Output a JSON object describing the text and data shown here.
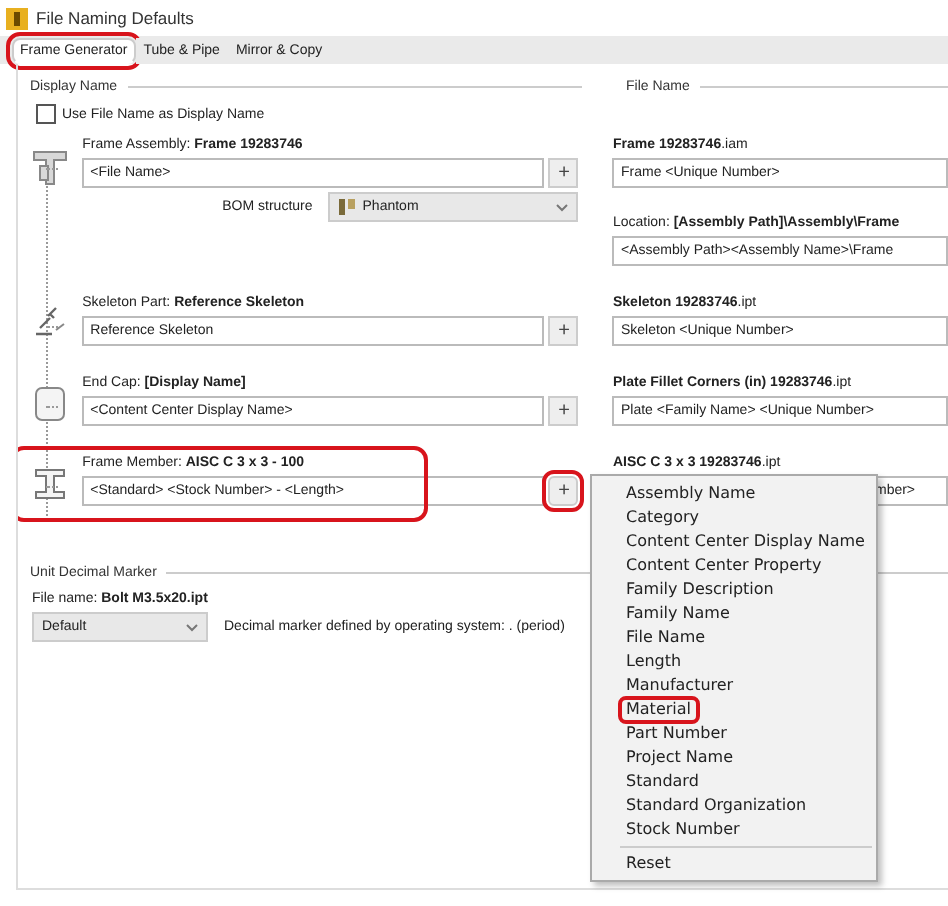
{
  "window": {
    "title": "File Naming Defaults"
  },
  "tabs": [
    {
      "label": "Frame Generator",
      "selected": true,
      "highlighted": true
    },
    {
      "label": "Tube & Pipe",
      "selected": false,
      "highlighted": false
    },
    {
      "label": "Mirror & Copy",
      "selected": false,
      "highlighted": false
    }
  ],
  "display_name": {
    "heading": "Display Name",
    "checkbox": {
      "label": "Use File Name as Display Name",
      "checked": false
    }
  },
  "file_name": {
    "heading": "File Name"
  },
  "rows": [
    {
      "kind": "assembly",
      "label": "Frame Assembly: **Frame 19283746**",
      "value": "<File Name>",
      "plus": "+",
      "highlighted": false,
      "plus_highlighted": false,
      "bom": {
        "label": "BOM structure",
        "value": "Phantom"
      },
      "file_label": "**Frame 19283746**.iam",
      "file_value": "Frame <Unique Number>",
      "location": {
        "label": "Location: **[Assembly Path]\\Assembly\\Frame**",
        "value": "<Assembly Path><Assembly Name>\\Frame"
      }
    },
    {
      "kind": "skeleton",
      "label": "Skeleton Part: **Reference Skeleton**",
      "value": "Reference Skeleton",
      "plus": "+",
      "highlighted": false,
      "plus_highlighted": false,
      "file_label": "**Skeleton 19283746**.ipt",
      "file_value": "Skeleton <Unique Number>"
    },
    {
      "kind": "end_cap",
      "label": "End Cap: **[Display Name]**",
      "value": "<Content Center Display Name>",
      "plus": "+",
      "highlighted": false,
      "plus_highlighted": false,
      "file_label": "**Plate Fillet Corners (in) 19283746**.ipt",
      "file_value": "Plate <Family Name> <Unique Number>"
    },
    {
      "kind": "member",
      "label": "Frame Member: **AISC C 3 x 3 - 100**",
      "value": "<Standard> <Stock Number> - <Length>",
      "plus": "+",
      "highlighted": true,
      "plus_highlighted": true,
      "file_label": "**AISC C 3 x 3 19283746**.ipt",
      "file_value": "mber>"
    }
  ],
  "unit_decimal": {
    "heading": "Unit Decimal Marker",
    "file_label": "File name: **Bolt M3.5x20.ipt**",
    "select": "Default",
    "note": "Decimal marker defined by operating system: . (period)"
  },
  "menu": {
    "items": [
      {
        "label": "Assembly Name",
        "highlighted": false
      },
      {
        "label": "Category",
        "highlighted": false
      },
      {
        "label": "Content Center Display Name",
        "highlighted": false
      },
      {
        "label": "Content Center Property",
        "highlighted": false
      },
      {
        "label": "Family Description",
        "highlighted": false
      },
      {
        "label": "Family Name",
        "highlighted": false
      },
      {
        "label": "File Name",
        "highlighted": false
      },
      {
        "label": "Length",
        "highlighted": false
      },
      {
        "label": "Manufacturer",
        "highlighted": false
      },
      {
        "label": "Material",
        "highlighted": true
      },
      {
        "label": "Part Number",
        "highlighted": false
      },
      {
        "label": "Project Name",
        "highlighted": false
      },
      {
        "label": "Standard",
        "highlighted": false
      },
      {
        "label": "Standard Organization",
        "highlighted": false
      },
      {
        "label": "Stock Number",
        "highlighted": false
      }
    ],
    "reset": "Reset"
  }
}
